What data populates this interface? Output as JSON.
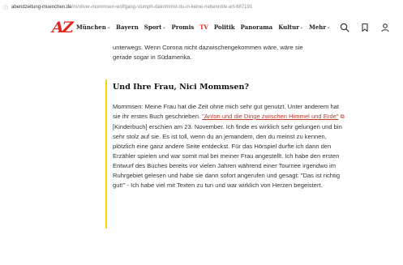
{
  "browser": {
    "url_host": "abendzeitung-muenchen.de",
    "url_path": "/m/oliver-mommsen-wolfgang-stumph-dakommst-du-in-keine-nebenrolle-art-687191"
  },
  "header": {
    "logo": "AZ",
    "nav": [
      {
        "label": "München",
        "has_caret": true
      },
      {
        "label": "Bayern",
        "has_caret": false
      },
      {
        "label": "Sport",
        "has_caret": true
      },
      {
        "label": "Promis",
        "has_caret": false
      },
      {
        "label": "TV",
        "has_caret": false,
        "highlight": true
      },
      {
        "label": "Politik",
        "has_caret": false
      },
      {
        "label": "Panorama",
        "has_caret": false
      },
      {
        "label": "Kultur",
        "has_caret": true
      },
      {
        "label": "Mehr",
        "has_caret": true
      }
    ],
    "icons": [
      "search-icon",
      "bookmark-icon",
      "user-icon"
    ]
  },
  "article": {
    "lead_line1": "unterwegs. Wenn Corona nicht dazwischengekommen wäre, wäre sie",
    "lead_line2": "gerade sogar in Südamerika.",
    "question": "Und Ihre Frau, Nici Mommsen?",
    "answer_start": "Mommsen: Meine Frau hat die Zeit ohne mich sehr gut genutzt. Unter anderem hat sie ihr erstes Buch geschrieben. ",
    "book_link": "\"Anton und die Dinge zwischen Himmel und Erde\"",
    "answer_rest": " [Kinderbuch] erschien am 23. November. Ich finde es wirklich sehr gelungen und bin sehr stolz auf sie. Es ist toll, wenn du an jemandem, den du meinst zu kennen, plötzlich eine ganz andere Seite entdeckst. Für das Hörspiel durfte ich dann den Erzähler spielen und war somit mal bei meiner Frau angestellt. Ich habe den ersten Entwurf des Buches bereits vor vielen Jahren während einer Tournee irgendwo im Ruhrgebiet gelesen und habe sie dann sofort angerufen und gesagt: \"Das ist richtig gut!\" - Ich habe viel mit Texten zu tun und war wirklich von Herzen begeistert."
  },
  "colors": {
    "brand": "#e3241b",
    "accent": "#f5d20a",
    "link": "#c0392b"
  }
}
